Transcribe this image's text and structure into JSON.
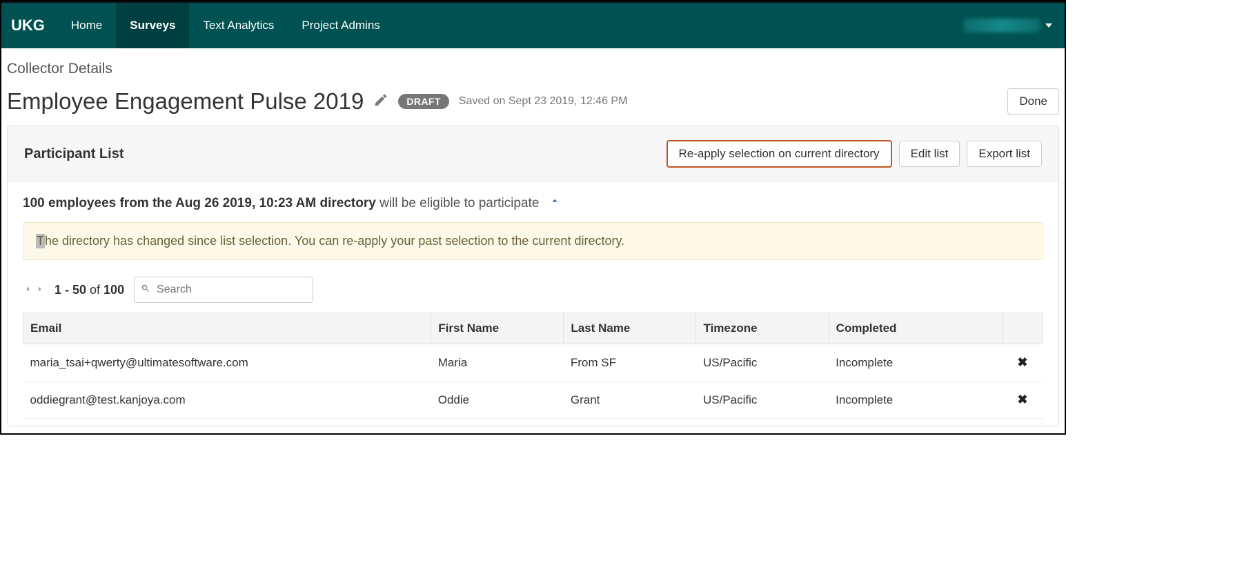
{
  "brand": "UKG",
  "nav": {
    "home": "Home",
    "surveys": "Surveys",
    "text_analytics": "Text Analytics",
    "project_admins": "Project Admins"
  },
  "breadcrumb": "Collector Details",
  "title": "Employee Engagement Pulse 2019",
  "status_badge": "DRAFT",
  "saved_text": "Saved on Sept 23 2019, 12:46 PM",
  "done_label": "Done",
  "panel": {
    "title": "Participant List",
    "reapply": "Re-apply selection on current directory",
    "edit": "Edit list",
    "export": "Export list"
  },
  "eligibility": {
    "strong": "100 employees from the Aug 26 2019, 10:23 AM directory",
    "regular": " will be eligible to participate"
  },
  "notice": {
    "first": "T",
    "rest": "he directory has changed since list selection. You can re-apply your past selection to the current directory."
  },
  "pager": {
    "range": "1 - 50",
    "of": " of ",
    "total": "100"
  },
  "search": {
    "placeholder": "Search"
  },
  "table": {
    "headers": {
      "email": "Email",
      "first": "First Name",
      "last": "Last Name",
      "tz": "Timezone",
      "completed": "Completed"
    },
    "rows": [
      {
        "email": "maria_tsai+qwerty@ultimatesoftware.com",
        "first": "Maria",
        "last": "From SF",
        "tz": "US/Pacific",
        "completed": "Incomplete"
      },
      {
        "email": "oddiegrant@test.kanjoya.com",
        "first": "Oddie",
        "last": "Grant",
        "tz": "US/Pacific",
        "completed": "Incomplete"
      }
    ]
  }
}
